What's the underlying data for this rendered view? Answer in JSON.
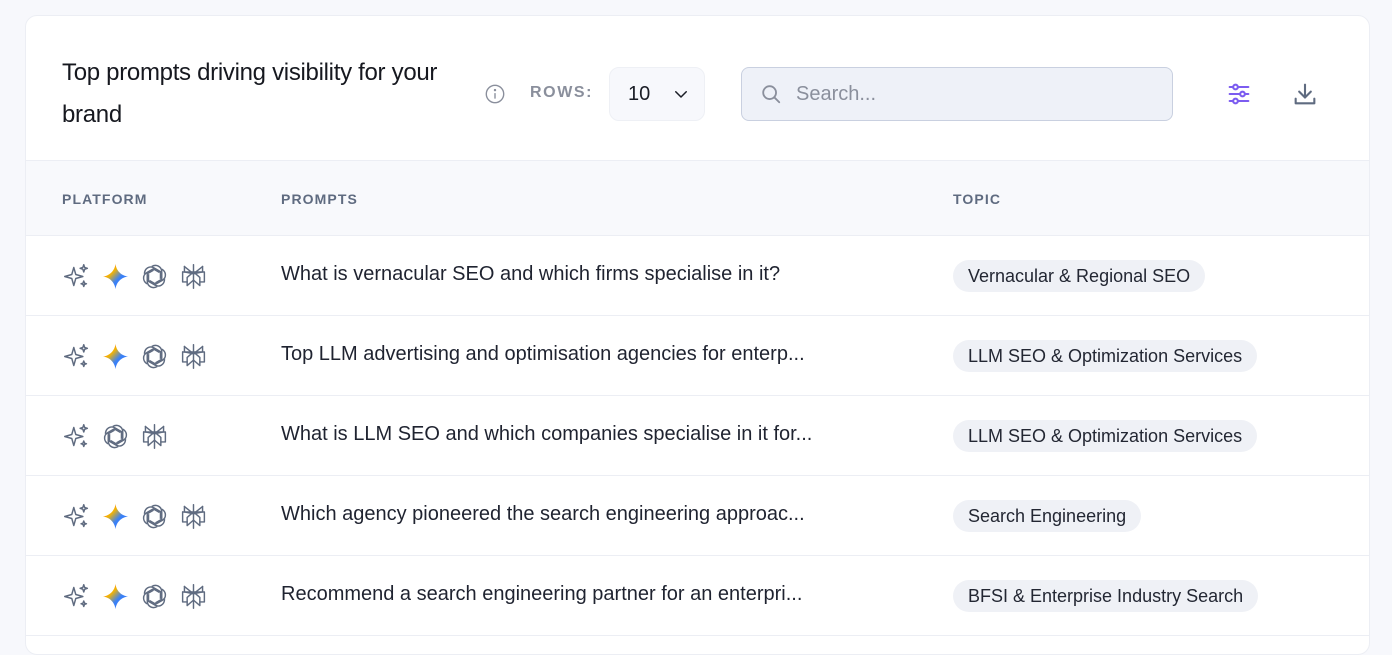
{
  "header": {
    "title": "Top prompts driving visibility for your brand",
    "rows_label": "ROWS:",
    "rows_value": "10",
    "search_placeholder": "Search..."
  },
  "columns": {
    "platform": "PLATFORM",
    "prompts": "PROMPTS",
    "topic": "TOPIC"
  },
  "rows": [
    {
      "platforms": [
        "sparkles-icon",
        "gemini-icon",
        "chatgpt-icon",
        "perplexity-icon"
      ],
      "prompt": "What is vernacular SEO and which firms specialise in it?",
      "topic": "Vernacular & Regional SEO"
    },
    {
      "platforms": [
        "sparkles-icon",
        "gemini-icon",
        "chatgpt-icon",
        "perplexity-icon"
      ],
      "prompt": "Top LLM advertising and optimisation agencies for enterp...",
      "topic": "LLM SEO & Optimization Services"
    },
    {
      "platforms": [
        "sparkles-icon",
        "chatgpt-icon",
        "perplexity-icon"
      ],
      "prompt": "What is LLM SEO and which companies specialise in it for...",
      "topic": "LLM SEO & Optimization Services"
    },
    {
      "platforms": [
        "sparkles-icon",
        "gemini-icon",
        "chatgpt-icon",
        "perplexity-icon"
      ],
      "prompt": "Which agency pioneered the search engineering approac...",
      "topic": "Search Engineering"
    },
    {
      "platforms": [
        "sparkles-icon",
        "gemini-icon",
        "chatgpt-icon",
        "perplexity-icon"
      ],
      "prompt": "Recommend a search engineering partner for an enterpri...",
      "topic": "BFSI & Enterprise Industry Search"
    }
  ],
  "colors": {
    "accent": "#7c5cf0",
    "gemini_blue": "#3b82f6",
    "gemini_red": "#ef4444",
    "gemini_yellow": "#f5b400",
    "icon_gray": "#5f6b80"
  }
}
